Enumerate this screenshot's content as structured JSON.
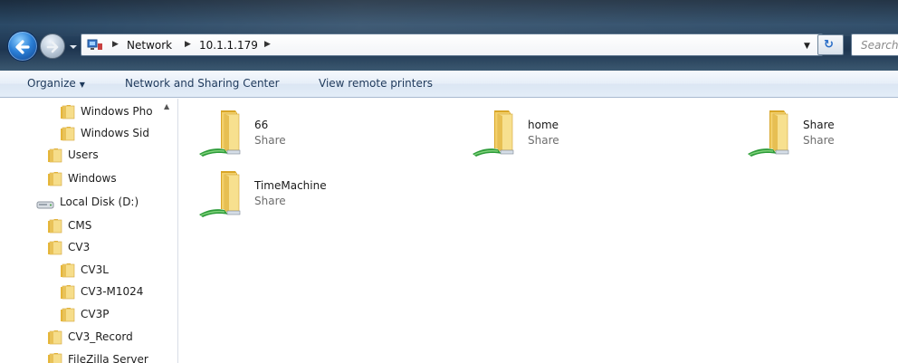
{
  "address_bar": {
    "breadcrumbs": [
      "Network",
      "10.1.1.179"
    ],
    "search_placeholder": "Search"
  },
  "command_bar": {
    "organize": "Organize",
    "network_sharing": "Network and Sharing Center",
    "view_printers": "View remote printers"
  },
  "sidebar": {
    "items": [
      {
        "label": "Windows Pho",
        "icon": "folder-icon"
      },
      {
        "label": "Windows Sid",
        "icon": "folder-icon"
      },
      {
        "label": "Users",
        "icon": "folder-icon"
      },
      {
        "label": "Windows",
        "icon": "folder-icon"
      },
      {
        "label": "Local Disk (D:)",
        "icon": "drive-icon"
      },
      {
        "label": "CMS",
        "icon": "folder-icon"
      },
      {
        "label": "CV3",
        "icon": "folder-icon"
      },
      {
        "label": "CV3L",
        "icon": "folder-icon"
      },
      {
        "label": "CV3-M1024",
        "icon": "folder-icon"
      },
      {
        "label": "CV3P",
        "icon": "folder-icon"
      },
      {
        "label": "CV3_Record",
        "icon": "folder-icon"
      },
      {
        "label": "FileZilla Server",
        "icon": "folder-icon"
      }
    ]
  },
  "shares": [
    {
      "name": "66",
      "type": "Share",
      "icon": "shared-folder-icon"
    },
    {
      "name": "home",
      "type": "Share",
      "icon": "shared-folder-icon"
    },
    {
      "name": "Share",
      "type": "Share",
      "icon": "shared-folder-icon"
    },
    {
      "name": "TimeMachine",
      "type": "Share",
      "icon": "shared-folder-icon"
    }
  ]
}
